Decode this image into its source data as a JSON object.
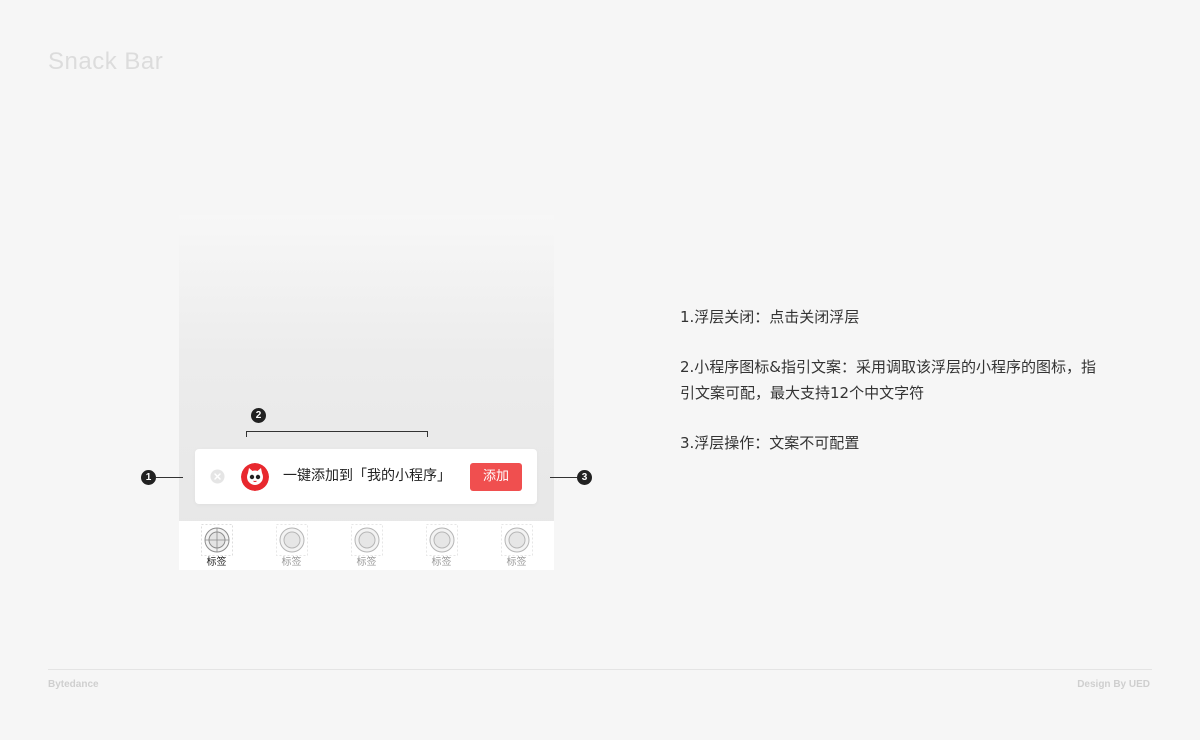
{
  "page": {
    "title": "Snack Bar"
  },
  "snackbar": {
    "text": "一键添加到「我的小程序」",
    "button_label": "添加",
    "accent_color": "#f04f4f",
    "close_icon": "close-circle-icon",
    "app_icon": "cat-logo-icon"
  },
  "tabbar": {
    "items": [
      {
        "label": "标签",
        "active": true
      },
      {
        "label": "标签",
        "active": false
      },
      {
        "label": "标签",
        "active": false
      },
      {
        "label": "标签",
        "active": false
      },
      {
        "label": "标签",
        "active": false
      }
    ]
  },
  "markers": [
    "1",
    "2",
    "3"
  ],
  "annotations": {
    "item1": "1.浮层关闭：点击关闭浮层",
    "item2": "2.小程序图标&指引文案：采用调取该浮层的小程序的图标，指引文案可配，最大支持12个中文字符",
    "item3": "3.浮层操作：文案不可配置"
  },
  "footer": {
    "left": "Bytedance",
    "right": "Design By UED"
  }
}
